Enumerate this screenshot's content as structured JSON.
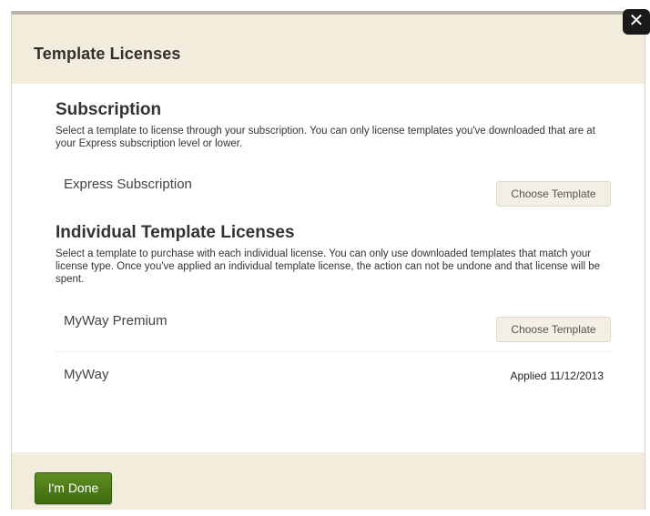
{
  "modal": {
    "title": "Template Licenses",
    "close_icon": "close-icon",
    "close_glyph": "✕"
  },
  "subscription": {
    "title": "Subscription",
    "description": "Select a template to license through your subscription. You can only license templates you've downloaded that are at your Express subscription level or lower.",
    "items": [
      {
        "name": "Express Subscription",
        "action_label": "Choose Template"
      }
    ]
  },
  "individual": {
    "title": "Individual Template Licenses",
    "description": "Select a template to purchase with each individual license. You can only use downloaded templates that match your license type. Once you've applied an individual template license, the action can not be undone and that license will be spent.",
    "items": [
      {
        "name": "MyWay Premium",
        "action_label": "Choose Template"
      },
      {
        "name": "MyWay",
        "status": "Applied 11/12/2013"
      }
    ]
  },
  "footer": {
    "done_label": "I'm Done"
  },
  "colors": {
    "modal_bg": "#f1ecdc",
    "body_bg": "#ffffff",
    "done_button": "#4a7c17",
    "close_button": "#1a1a1a"
  }
}
